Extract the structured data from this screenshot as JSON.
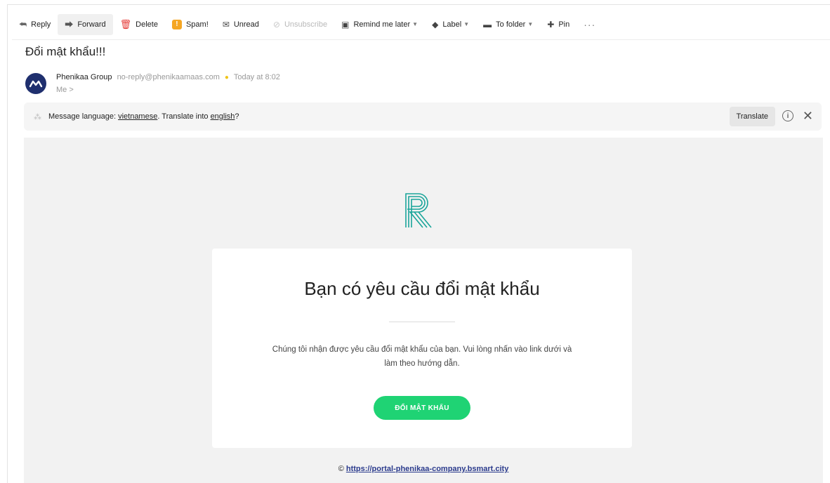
{
  "toolbar": {
    "reply": "Reply",
    "forward": "Forward",
    "delete": "Delete",
    "spam": "Spam!",
    "unread": "Unread",
    "unsubscribe": "Unsubscribe",
    "remind": "Remind me later",
    "label": "Label",
    "folder": "To folder",
    "pin": "Pin",
    "more": "···"
  },
  "message": {
    "subject": "Đổi mật khẩu!!!",
    "sender_name": "Phenikaa Group",
    "sender_email": "no-reply@phenikaamaas.com",
    "time": "Today at 8:02",
    "recipient": "Me >"
  },
  "translate": {
    "prefix": "Message language: ",
    "language": "vietnamese",
    "middle": ". Translate into ",
    "target": "english",
    "suffix": "?",
    "button": "Translate"
  },
  "email": {
    "title": "Bạn có yêu cầu đổi mật khẩu",
    "line1": "Chúng tôi nhận được yêu cầu đổi mật khẩu của bạn. Vui lòng nhấn vào link dưới và",
    "line2": "làm theo hướng dẫn.",
    "button": "ĐỔI MẬT KHẨU",
    "footer_symbol": "©",
    "footer_link": "https://portal-phenikaa-company.bsmart.city"
  },
  "colors": {
    "accent_green": "#1fd374",
    "avatar_navy": "#1f2f6e",
    "logo_teal": "#1aa59a"
  }
}
